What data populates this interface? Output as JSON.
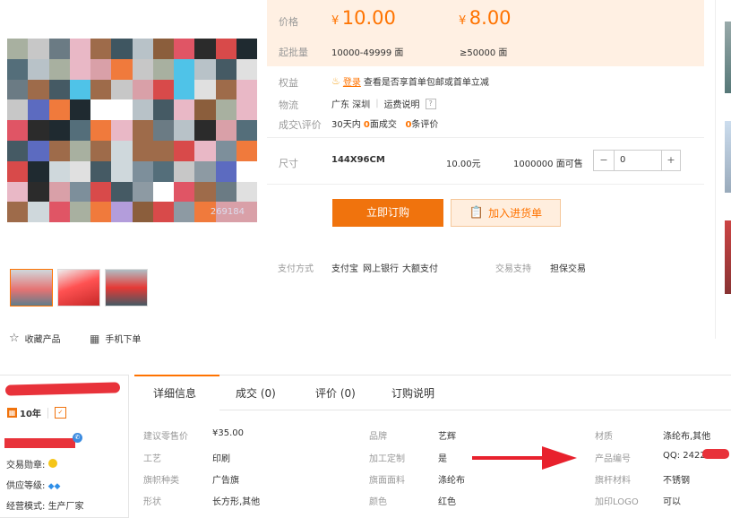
{
  "price": {
    "label": "价格",
    "currency": "¥",
    "tier1_price": "10.00",
    "tier2_price": "8.00",
    "moq_label": "起批量",
    "tier1_range": "10000-49999 面",
    "tier2_range": "≥50000 面"
  },
  "rights": {
    "label": "权益",
    "badge": "登录",
    "text": "查看是否享首单包邮或首单立减"
  },
  "logistics": {
    "label": "物流",
    "location": "广东 深圳",
    "sep": "|",
    "fee_link": "运费说明",
    "help": "?"
  },
  "deals": {
    "label": "成交\\评价",
    "prefix": "30天内",
    "count": "0",
    "count_unit": "面成交",
    "reviews": "0",
    "reviews_unit": "条评价"
  },
  "sku": {
    "label": "尺寸",
    "size": "144X96CM",
    "price": "10.00元",
    "stock": "1000000 面可售",
    "minus": "−",
    "qty": "0",
    "plus": "+"
  },
  "actions": {
    "order_now": "立即订购",
    "add_cart": "加入进货单"
  },
  "payment": {
    "label": "支付方式",
    "methods": [
      "支付宝",
      "网上银行",
      "大额支付"
    ],
    "support_label": "交易支持",
    "support_value": "担保交易"
  },
  "gallery": {
    "watermark": "269184",
    "favorite": "收藏产品",
    "mobile_order": "手机下单"
  },
  "seller": {
    "years": "10年",
    "medal_label": "交易勋章:",
    "level_label": "供应等级:",
    "mode_label": "经营模式:",
    "mode_value": "生产厂家"
  },
  "tabs": [
    "详细信息",
    "成交 (0)",
    "评价 (0)",
    "订购说明"
  ],
  "attributes": {
    "col1": [
      {
        "k": "建议零售价",
        "v": "¥35.00"
      },
      {
        "k": "工艺",
        "v": "印刷"
      },
      {
        "k": "旗帜种类",
        "v": "广告旗"
      },
      {
        "k": "形状",
        "v": "长方形,其他"
      }
    ],
    "col2": [
      {
        "k": "品牌",
        "v": "艺辉"
      },
      {
        "k": "加工定制",
        "v": "是"
      },
      {
        "k": "旗面面料",
        "v": "涤纶布"
      },
      {
        "k": "颜色",
        "v": "红色"
      }
    ],
    "col3": [
      {
        "k": "材质",
        "v": "涤纶布,其他"
      },
      {
        "k": "产品编号",
        "v": "QQ: 2422"
      },
      {
        "k": "旗杆材料",
        "v": "不锈钢"
      },
      {
        "k": "加印LOGO",
        "v": "可以"
      }
    ]
  },
  "colors": {
    "accent": "#ff7300",
    "price_band": "#fff0e3",
    "primary_btn": "#f0730d",
    "arrow": "#e8212d",
    "redact": "#e8323a"
  }
}
